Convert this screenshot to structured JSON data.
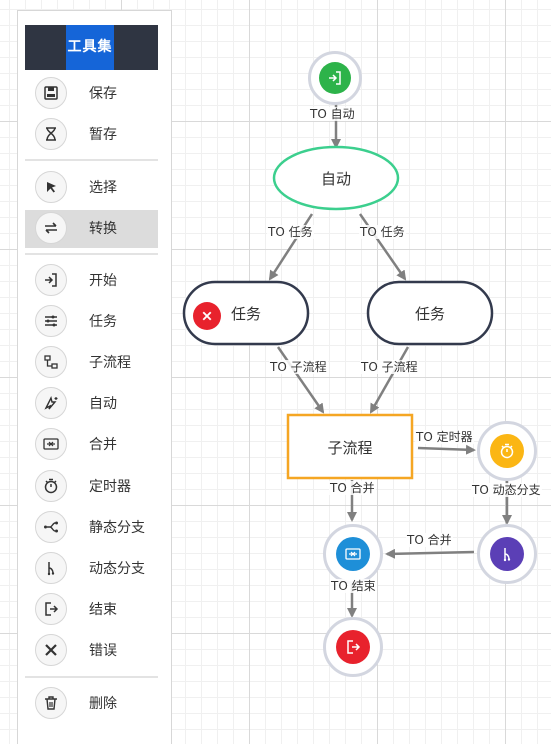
{
  "toolbox": {
    "title": "工具集",
    "tools": [
      {
        "label": "保存",
        "icon": "save-icon"
      },
      {
        "label": "暂存",
        "icon": "hourglass-icon"
      },
      {
        "label": "选择",
        "icon": "pointer-icon"
      },
      {
        "label": "转换",
        "icon": "transfer-icon",
        "active": true
      },
      {
        "label": "开始",
        "icon": "start-icon"
      },
      {
        "label": "任务",
        "icon": "task-icon"
      },
      {
        "label": "子流程",
        "icon": "subprocess-icon"
      },
      {
        "label": "自动",
        "icon": "auto-icon"
      },
      {
        "label": "合并",
        "icon": "merge-icon"
      },
      {
        "label": "定时器",
        "icon": "timer-icon"
      },
      {
        "label": "静态分支",
        "icon": "static-branch-icon"
      },
      {
        "label": "动态分支",
        "icon": "dynamic-branch-icon"
      },
      {
        "label": "结束",
        "icon": "end-icon"
      },
      {
        "label": "错误",
        "icon": "error-icon"
      },
      {
        "label": "删除",
        "icon": "delete-icon"
      }
    ]
  },
  "diagram": {
    "nodes": {
      "auto": "自动",
      "task_left": "任务",
      "task_right": "任务",
      "subprocess": "子流程"
    },
    "edges": {
      "start_to_auto": "TO 自动",
      "auto_to_task_left": "TO 任务",
      "auto_to_task_right": "TO 任务",
      "task_left_to_sub": "TO 子流程",
      "task_right_to_sub": "TO 子流程",
      "sub_to_timer": "TO 定时器",
      "sub_to_merge": "TO 合并",
      "timer_to_dynamic": "TO 动态分支",
      "dynamic_to_merge": "TO 合并",
      "merge_to_end": "TO 结束"
    }
  },
  "colors": {
    "start": "#2db34a",
    "auto_border": "#3ccf8e",
    "task_border": "#333a4d",
    "error": "#e8222d",
    "subprocess_border": "#f5a623",
    "timer": "#fbb614",
    "merge": "#1e8fd8",
    "dynamic_branch": "#5b3fb6",
    "end": "#e8222d",
    "toolbox_header": "#2f3542",
    "toolbox_title_bg": "#1565d8",
    "edge": "#808080"
  }
}
